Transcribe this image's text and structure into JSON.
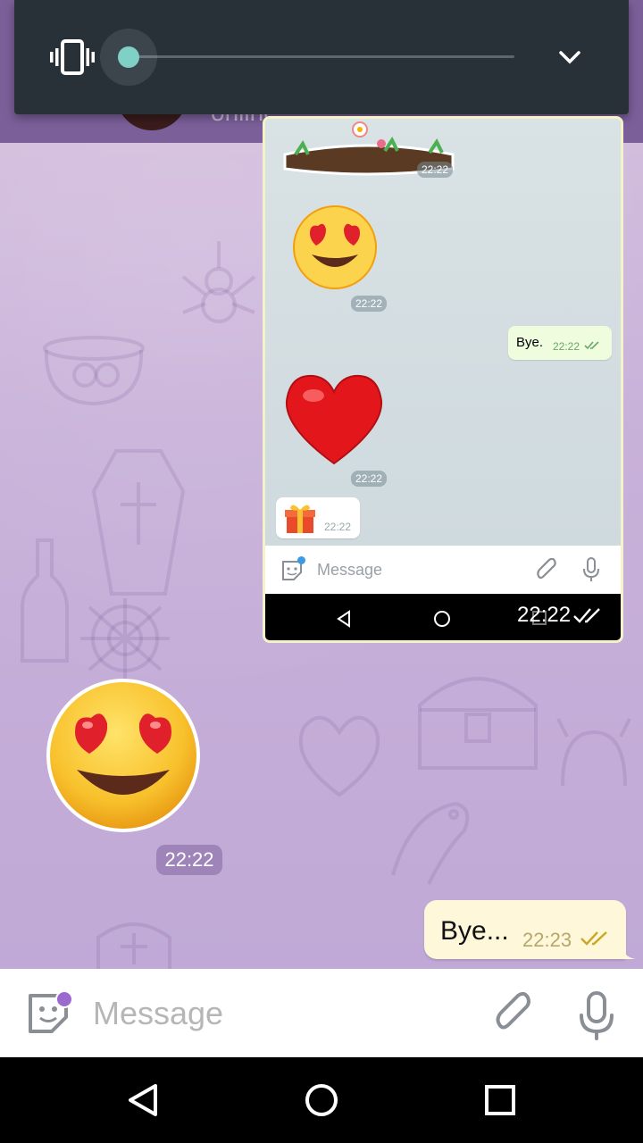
{
  "header": {
    "status": "online"
  },
  "volume_panel": {
    "level": 0,
    "mode_icon": "vibrate-icon",
    "expand_icon": "chevron-down-icon",
    "accent_color": "#7fd0c6"
  },
  "embedded_screenshot": {
    "sticker_time": "22:22",
    "love_emoji_time": "22:22",
    "outgoing_text": "Bye.",
    "outgoing_time": "22:22",
    "heart_time": "22:22",
    "gift_time": "22:22",
    "input_placeholder": "Message",
    "nav_time": "22:22"
  },
  "messages": {
    "sticker_time": "22:22",
    "outgoing_text": "Bye...",
    "outgoing_time": "22:23"
  },
  "input_bar": {
    "placeholder": "Message",
    "value": ""
  },
  "colors": {
    "header": "#7b5f99",
    "outgoing_bubble": "#fef7d9",
    "sticker_badge": "#9b6ad0"
  }
}
